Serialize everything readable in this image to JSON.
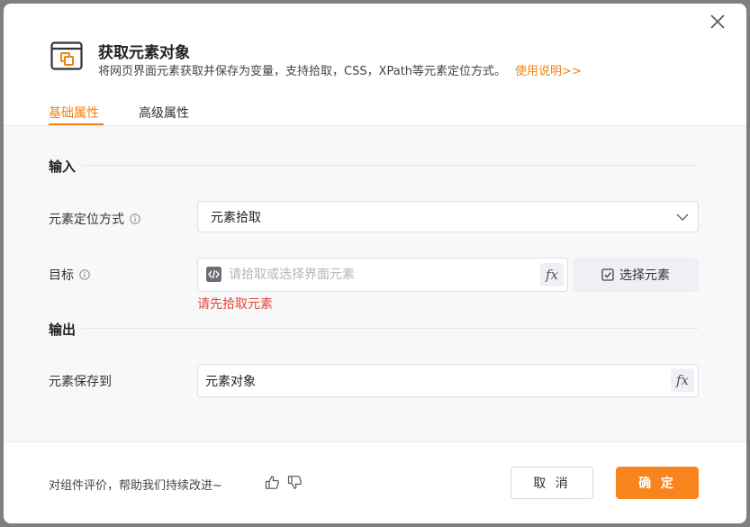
{
  "dialog": {
    "title": "获取元素对象",
    "subtitle": "将网页界面元素获取并保存为变量，支持拾取，CSS，XPath等元素定位方式。",
    "help_link": "使用说明>>"
  },
  "tabs": [
    {
      "label": "基础属性",
      "active": true
    },
    {
      "label": "高级属性",
      "active": false
    }
  ],
  "input_section": {
    "title": "输入",
    "locate_label": "元素定位方式",
    "locate_value": "元素拾取",
    "target_label": "目标",
    "target_placeholder": "请拾取或选择界面元素",
    "select_element_button": "选择元素",
    "error_message": "请先拾取元素"
  },
  "output_section": {
    "title": "输出",
    "save_label": "元素保存到",
    "save_value": "元素对象"
  },
  "footer": {
    "feedback_text": "对组件评价，帮助我们持续改进~",
    "cancel_label": "取 消",
    "ok_label": "确 定"
  },
  "colors": {
    "accent": "#f0820f",
    "error": "#e5483d",
    "primary_button": "#f7841d"
  },
  "icons": [
    "close-icon",
    "window-icon",
    "info-icon",
    "chevron-down-icon",
    "code-icon",
    "fx-icon",
    "checkbox-icon",
    "thumbs-up-icon",
    "thumbs-down-icon"
  ]
}
